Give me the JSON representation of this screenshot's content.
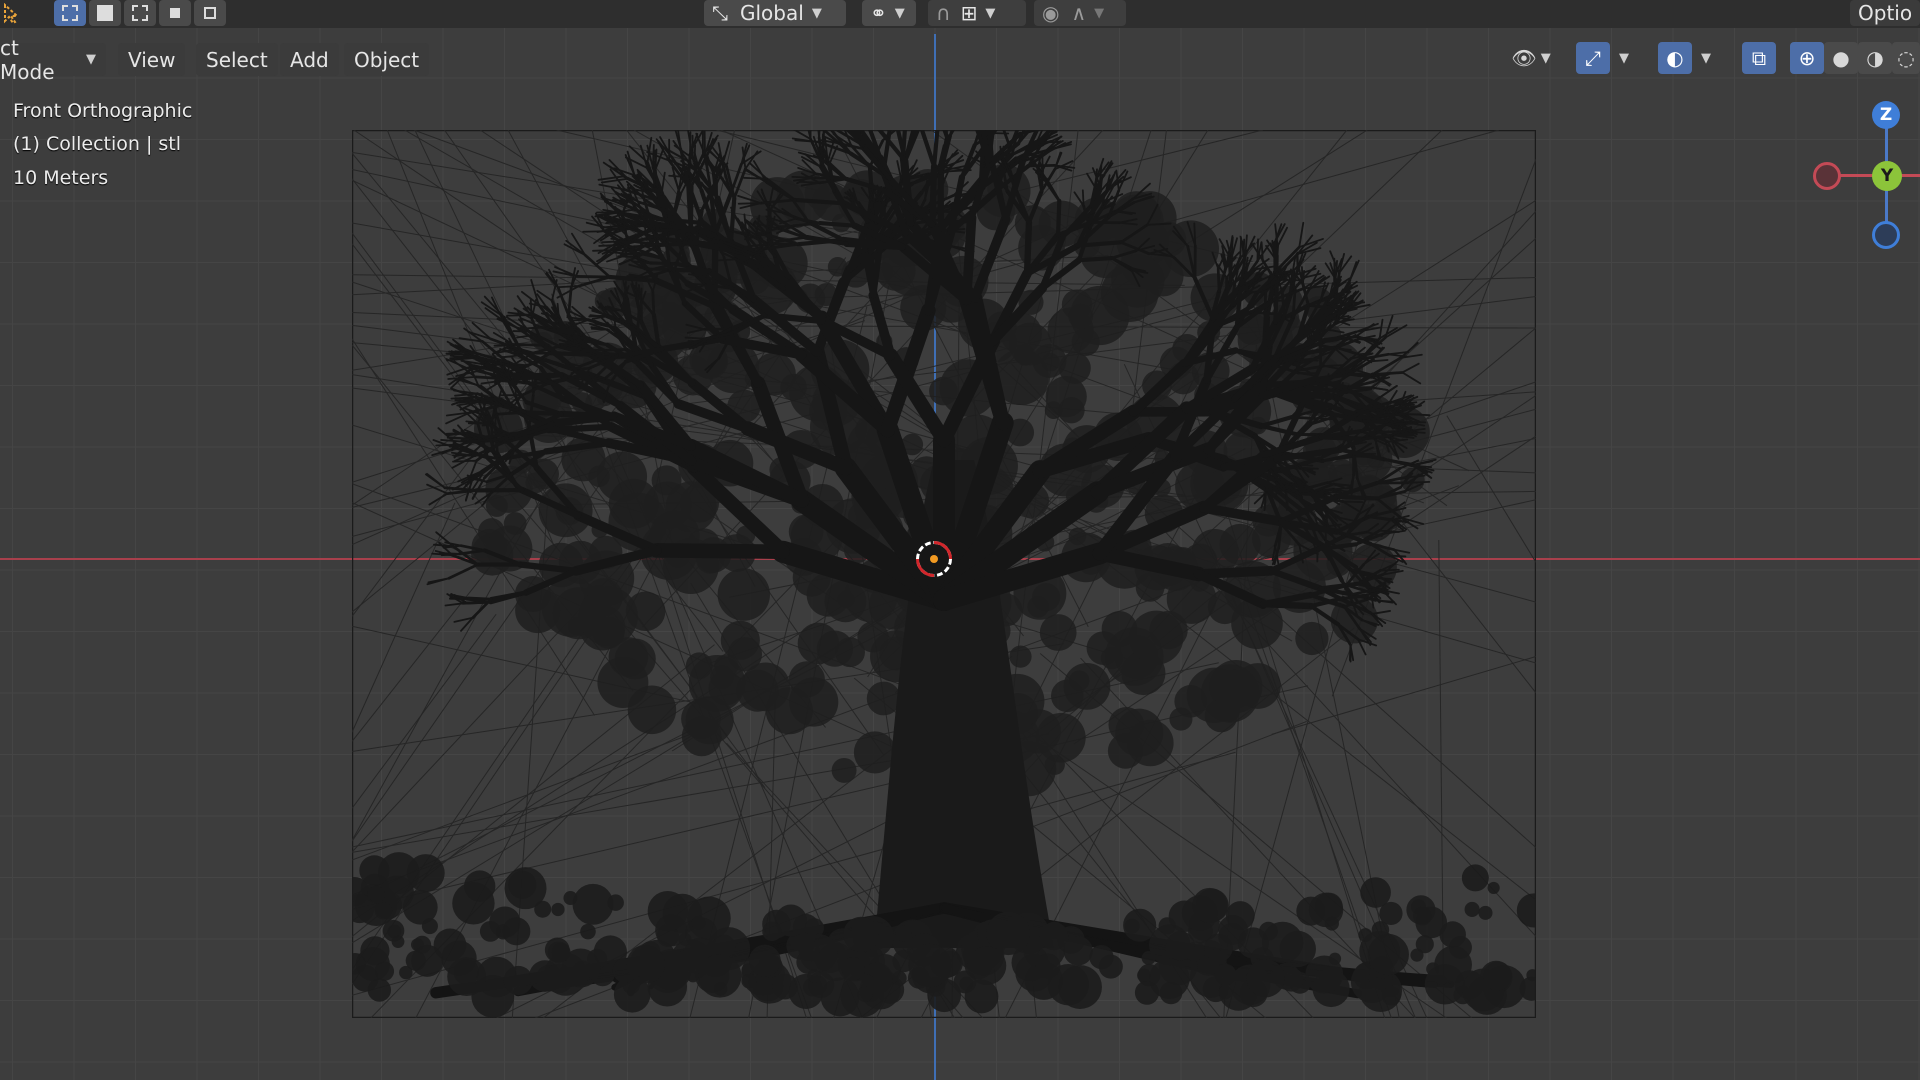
{
  "header": {
    "mode_label": "ct Mode",
    "menus": [
      "View",
      "Select",
      "Add",
      "Object"
    ],
    "transform_orientation": "Global",
    "options_label": "Optio"
  },
  "viewport": {
    "view_name": "Front Orthographic",
    "collection": "(1) Collection | stl",
    "scale": "10 Meters"
  },
  "gizmo": {
    "z_label": "Z",
    "y_label": "Y"
  },
  "colors": {
    "accent_blue": "#4d6ea8",
    "axis_red": "#a8404c",
    "axis_blue": "#3f6fb5",
    "gizmo_z": "#3f7ed8",
    "gizmo_y": "#8cc43a",
    "gizmo_x": "#d6414f",
    "mesh_wire": "#1b1b1b"
  },
  "icons": {
    "select_modes": [
      "select-box-icon",
      "select-extend-icon",
      "select-subtract-icon",
      "select-invert-icon",
      "select-intersect-icon"
    ],
    "header_left": "cursor-tool-icon",
    "orientation": "transform-orientation-icon",
    "pivot": "pivot-point-icon",
    "snap": "snap-magnet-icon",
    "snap_target": "snap-increment-icon",
    "proportional": "proportional-edit-icon",
    "falloff": "falloff-curve-icon",
    "visibility": "eye-icon",
    "gizmos": "gizmo-toggle-icon",
    "overlays": "overlays-icon",
    "xray": "xray-icon",
    "shading": [
      "wireframe-shading-icon",
      "solid-shading-icon",
      "material-shading-icon",
      "rendered-shading-icon"
    ]
  }
}
